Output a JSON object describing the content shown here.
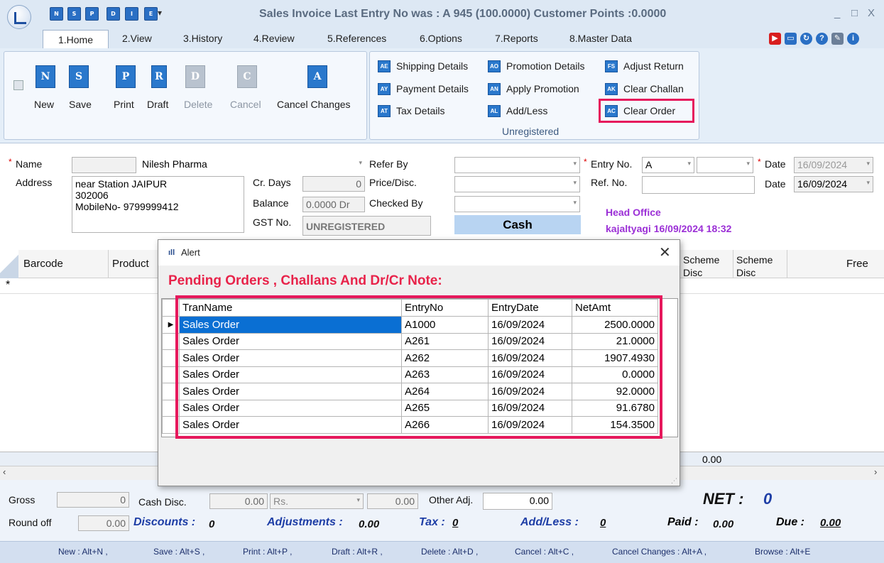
{
  "window": {
    "title": "Sales Invoice    Last Entry No was : A 945  (100.0000)  Customer Points :0.0000",
    "minimize": "_",
    "maximize": "□",
    "close": "X"
  },
  "quick_access": [
    "N",
    "S",
    "P",
    "D",
    "I",
    "E"
  ],
  "tabs": [
    "1.Home",
    "2.View",
    "3.History",
    "4.Review",
    "5.References",
    "6.Options",
    "7.Reports",
    "8.Master Data"
  ],
  "ribbon": {
    "big_buttons": [
      {
        "glyph": "N",
        "label": "New"
      },
      {
        "glyph": "S",
        "label": "Save"
      },
      {
        "glyph": "P",
        "label": "Print"
      },
      {
        "glyph": "R",
        "label": "Draft"
      },
      {
        "glyph": "D",
        "label": "Delete"
      },
      {
        "glyph": "C",
        "label": "Cancel"
      },
      {
        "glyph": "A",
        "label": "Cancel Changes"
      }
    ],
    "small_buttons": [
      {
        "glyph": "AE",
        "label": "Shipping Details"
      },
      {
        "glyph": "AY",
        "label": "Payment Details"
      },
      {
        "glyph": "AT",
        "label": "Tax Details"
      },
      {
        "glyph": "AO",
        "label": "Promotion Details"
      },
      {
        "glyph": "AN",
        "label": "Apply Promotion"
      },
      {
        "glyph": "AL",
        "label": "Add/Less"
      },
      {
        "glyph": "FS",
        "label": "Adjust Return"
      },
      {
        "glyph": "AK",
        "label": "Clear Challan"
      },
      {
        "glyph": "AC",
        "label": "Clear Order"
      }
    ],
    "group_label": "Unregistered"
  },
  "form": {
    "name_label": "Name",
    "name_value": "Nilesh Pharma",
    "address_label": "Address",
    "address_lines": [
      "near Station JAIPUR",
      "302006",
      "MobileNo- 9799999412"
    ],
    "cr_days_label": "Cr. Days",
    "cr_days_value": "0",
    "balance_label": "Balance",
    "balance_value": "0.0000 Dr",
    "gst_label": "GST No.",
    "gst_value": "UNREGISTERED",
    "refer_by_label": "Refer By",
    "price_disc_label": "Price/Disc.",
    "checked_by_label": "Checked By",
    "cash_label": "Cash",
    "entry_no_label": "Entry No.",
    "entry_no_value": "A",
    "ref_no_label": "Ref. No.",
    "date_label": "Date",
    "date1_value": "16/09/2024",
    "date2_label": "Date",
    "date2_value": "16/09/2024",
    "branch": "Head Office",
    "user_stamp": "kajaltyagi 16/09/2024 18:32"
  },
  "grid": {
    "headers": [
      "Barcode",
      "Product",
      "Scheme Disc",
      "Scheme Disc",
      "Free"
    ],
    "new_row_marker": "*",
    "footer_total": "0.00"
  },
  "dialog": {
    "title": "Alert",
    "heading": "Pending Orders , Challans And Dr/Cr Note:",
    "columns": [
      "TranName",
      "EntryNo",
      "EntryDate",
      "NetAmt"
    ],
    "rows": [
      [
        "Sales Order",
        "A1000",
        "16/09/2024",
        "2500.0000"
      ],
      [
        "Sales Order",
        "A261",
        "16/09/2024",
        "21.0000"
      ],
      [
        "Sales Order",
        "A262",
        "16/09/2024",
        "1907.4930"
      ],
      [
        "Sales Order",
        "A263",
        "16/09/2024",
        "0.0000"
      ],
      [
        "Sales Order",
        "A264",
        "16/09/2024",
        "92.0000"
      ],
      [
        "Sales Order",
        "A265",
        "16/09/2024",
        "91.6780"
      ],
      [
        "Sales Order",
        "A266",
        "16/09/2024",
        "154.3500"
      ]
    ]
  },
  "totals": {
    "gross_label": "Gross",
    "gross_value": "0",
    "cash_disc_label": "Cash Disc.",
    "cash_disc_value": "0.00",
    "cash_disc_unit": "Rs.",
    "other_mid_value": "0.00",
    "other_adj_label": "Other Adj.",
    "other_adj_value": "0.00",
    "net_label": "NET :",
    "net_value": "0",
    "round_off_label": "Round off",
    "round_off_value": "0.00",
    "discounts_label": "Discounts :",
    "discounts_value": "0",
    "adjustments_label": "Adjustments :",
    "adjustments_value": "0.00",
    "tax_label": "Tax :",
    "tax_value": "0",
    "addless_label": "Add/Less :",
    "addless_value": "0",
    "paid_label": "Paid :",
    "paid_value": "0.00",
    "due_label": "Due :",
    "due_value": "0.00"
  },
  "shortcuts": [
    "New : Alt+N ,",
    "Save : Alt+S ,",
    "Print : Alt+P ,",
    "Draft : Alt+R ,",
    "Delete : Alt+D ,",
    "Cancel : Alt+C ,",
    "Cancel Changes : Alt+A ,",
    "Browse : Alt+E"
  ],
  "colors": {
    "accent": "#2a78cc",
    "highlight": "#e6185c",
    "heading_red": "#e8234a",
    "selection": "#0a6fd3",
    "branch_purple": "#9b2fd6"
  }
}
